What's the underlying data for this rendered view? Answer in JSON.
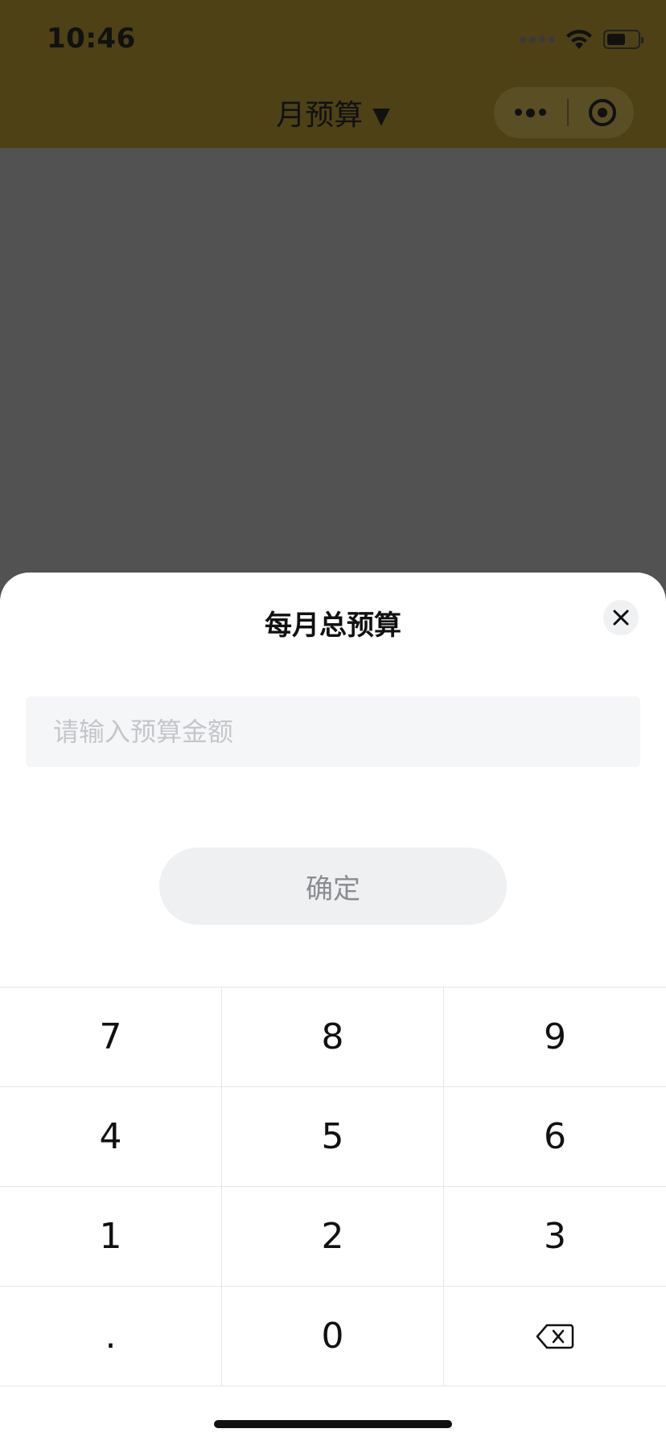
{
  "status_bar": {
    "time": "10:46"
  },
  "nav": {
    "title": "月预算",
    "caret": "▼"
  },
  "sheet": {
    "title": "每月总预算",
    "input_placeholder": "请输入预算金额",
    "input_value": "",
    "confirm_label": "确定",
    "keys": [
      "7",
      "8",
      "9",
      "4",
      "5",
      "6",
      "1",
      "2",
      "3",
      ".",
      "0"
    ],
    "backspace_icon": "backspace-icon"
  }
}
